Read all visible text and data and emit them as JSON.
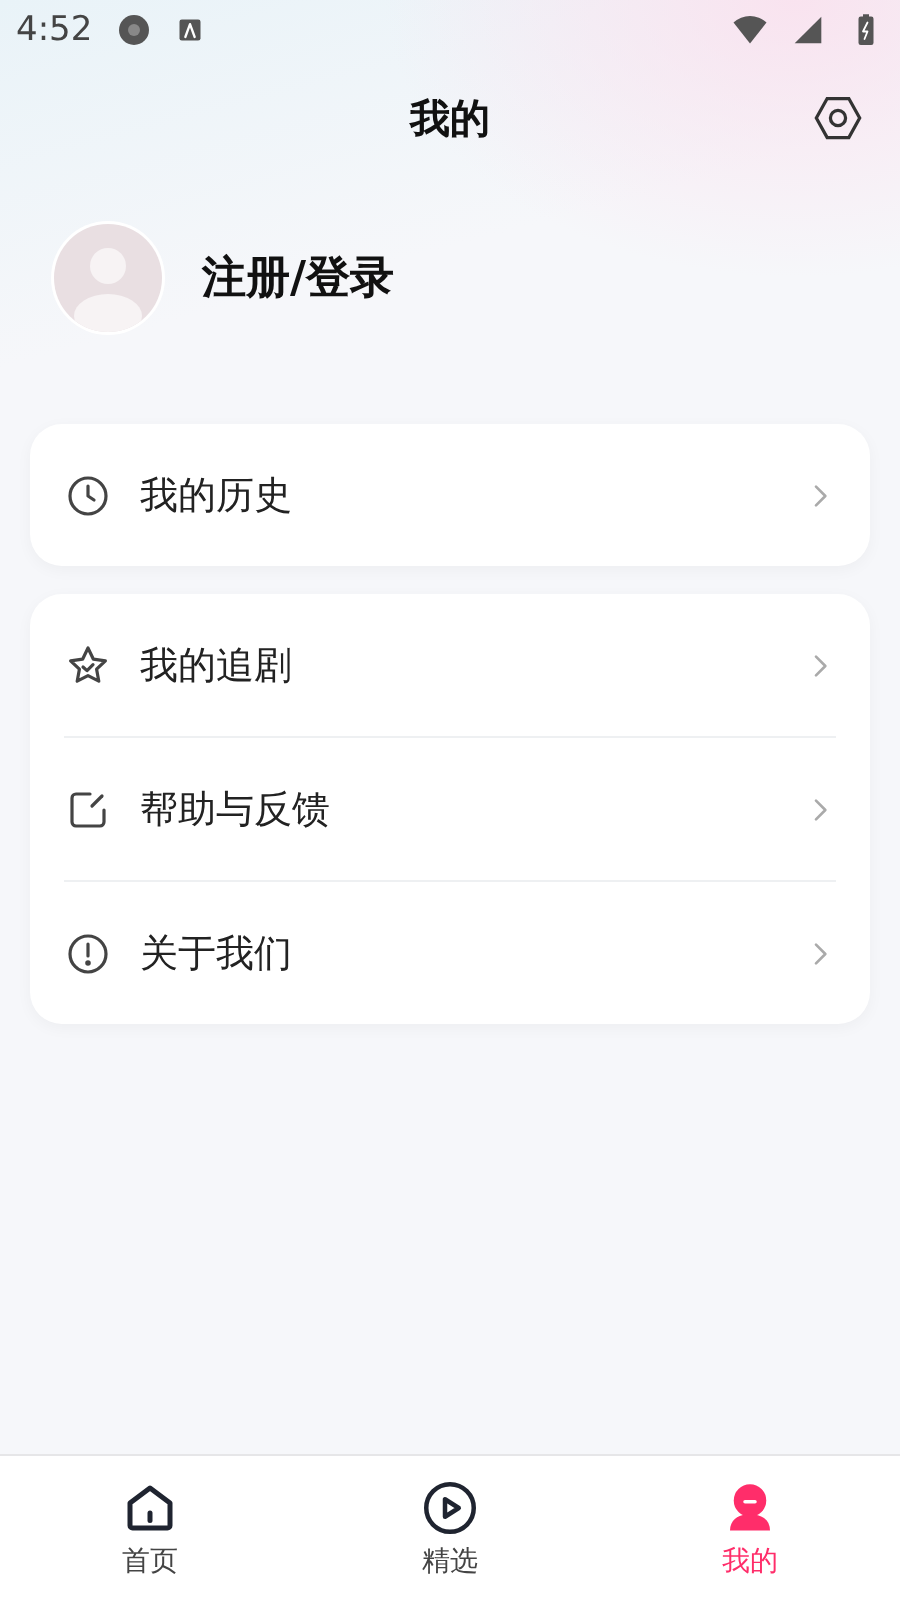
{
  "status_bar": {
    "time": "4:52"
  },
  "header": {
    "title": "我的"
  },
  "profile": {
    "login_label": "注册/登录"
  },
  "menu_groups": [
    {
      "items": [
        {
          "kind": "clock",
          "label": "我的历史"
        }
      ]
    },
    {
      "items": [
        {
          "kind": "star",
          "label": "我的追剧"
        },
        {
          "kind": "edit",
          "label": "帮助与反馈"
        },
        {
          "kind": "info",
          "label": "关于我们"
        }
      ]
    }
  ],
  "bottom_nav": [
    {
      "kind": "home",
      "label": "首页",
      "selected": false
    },
    {
      "kind": "play",
      "label": "精选",
      "selected": false
    },
    {
      "kind": "person",
      "label": "我的",
      "selected": true
    }
  ]
}
